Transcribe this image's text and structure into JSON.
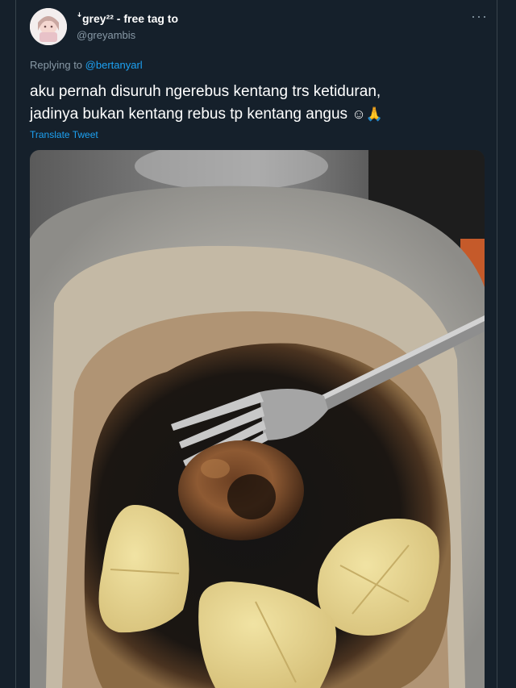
{
  "tweet": {
    "display_name": "ꜜgrey²² - free tag to",
    "handle": "@greyambis",
    "more_icon": "more-dots-icon",
    "replying_prefix": "Replying to",
    "replying_to": "@bertanyarl",
    "text_line1": "aku pernah disuruh ngerebus kentang trs ketiduran,",
    "text_line2": "jadinya bukan kentang rebus tp kentang angus",
    "emojis": "☺🙏",
    "translate_label": "Translate Tweet",
    "media": {
      "alt_icon": "photo-burnt-potatoes-in-pan"
    }
  },
  "colors": {
    "background": "#15202b",
    "text": "#ffffff",
    "muted": "#8899a6",
    "link": "#1da1f2",
    "divider": "#38444d"
  }
}
